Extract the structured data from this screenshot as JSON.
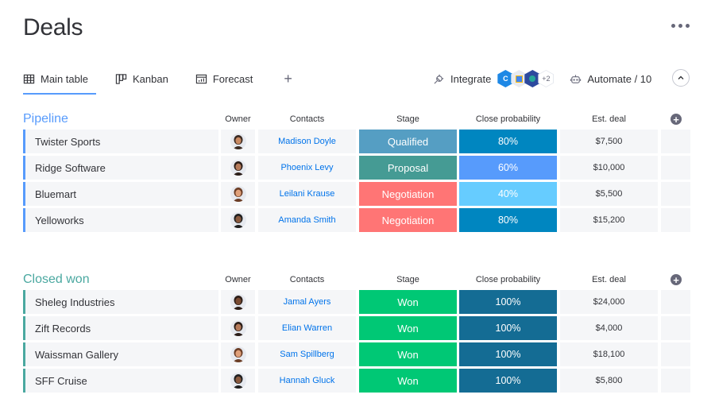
{
  "header": {
    "title": "Deals",
    "more_label": "More options"
  },
  "tabs": [
    {
      "label": "Main table",
      "icon": "table-icon",
      "active": true
    },
    {
      "label": "Kanban",
      "icon": "kanban-icon",
      "active": false
    },
    {
      "label": "Forecast",
      "icon": "chart-icon",
      "active": false
    }
  ],
  "toolbar": {
    "add_view": "+",
    "integrate_label": "Integrate",
    "apps_more": "+2",
    "automate_label": "Automate / 10"
  },
  "columns": {
    "owner": "Owner",
    "contacts": "Contacts",
    "stage": "Stage",
    "probability": "Close probability",
    "deal": "Est. deal",
    "add": "+"
  },
  "colors": {
    "pipeline": "#579bfc",
    "closed_won": "#4aa8a0",
    "qualified": "#559ec3",
    "proposal": "#459b94",
    "negotiation": "#ff7575",
    "won": "#00c875",
    "p80": "#0086c0",
    "p60": "#579bfc",
    "p40": "#66ccff",
    "p100": "#146c94"
  },
  "groups": [
    {
      "title": "Pipeline",
      "color_key": "pipeline",
      "rows": [
        {
          "name": "Twister Sports",
          "contact": "Madison Doyle",
          "stage": "Qualified",
          "stage_color": "qualified",
          "probability": "80%",
          "prob_color": "p80",
          "deal": "$7,500",
          "avatar": [
            "#3a2a22",
            "#c98a63"
          ]
        },
        {
          "name": "Ridge Software",
          "contact": "Phoenix Levy",
          "stage": "Proposal",
          "stage_color": "proposal",
          "probability": "60%",
          "prob_color": "p60",
          "deal": "$10,000",
          "avatar": [
            "#2a1d18",
            "#b67b5b"
          ]
        },
        {
          "name": "Bluemart",
          "contact": "Leilani Krause",
          "stage": "Negotiation",
          "stage_color": "negotiation",
          "probability": "40%",
          "prob_color": "p40",
          "deal": "$5,500",
          "avatar": [
            "#6b3d25",
            "#e0a07a"
          ]
        },
        {
          "name": "Yelloworks",
          "contact": "Amanda Smith",
          "stage": "Negotiation",
          "stage_color": "negotiation",
          "probability": "80%",
          "prob_color": "p80",
          "deal": "$15,200",
          "avatar": [
            "#1f1f1f",
            "#8a5a3f"
          ]
        }
      ]
    },
    {
      "title": "Closed won",
      "color_key": "closed_won",
      "rows": [
        {
          "name": "Sheleg Industries",
          "contact": "Jamal Ayers",
          "stage": "Won",
          "stage_color": "won",
          "probability": "100%",
          "prob_color": "p100",
          "deal": "$24,000",
          "avatar": [
            "#2b1d17",
            "#7a4b32"
          ]
        },
        {
          "name": "Zift Records",
          "contact": "Elian Warren",
          "stage": "Won",
          "stage_color": "won",
          "probability": "100%",
          "prob_color": "p100",
          "deal": "$4,000",
          "avatar": [
            "#2a1d18",
            "#b67b5b"
          ]
        },
        {
          "name": "Waissman Gallery",
          "contact": "Sam Spillberg",
          "stage": "Won",
          "stage_color": "won",
          "probability": "100%",
          "prob_color": "p100",
          "deal": "$18,100",
          "avatar": [
            "#6b3d25",
            "#e0a07a"
          ]
        },
        {
          "name": "SFF Cruise",
          "contact": "Hannah Gluck",
          "stage": "Won",
          "stage_color": "won",
          "probability": "100%",
          "prob_color": "p100",
          "deal": "$5,800",
          "avatar": [
            "#1f1f1f",
            "#8a5a3f"
          ]
        }
      ]
    }
  ]
}
